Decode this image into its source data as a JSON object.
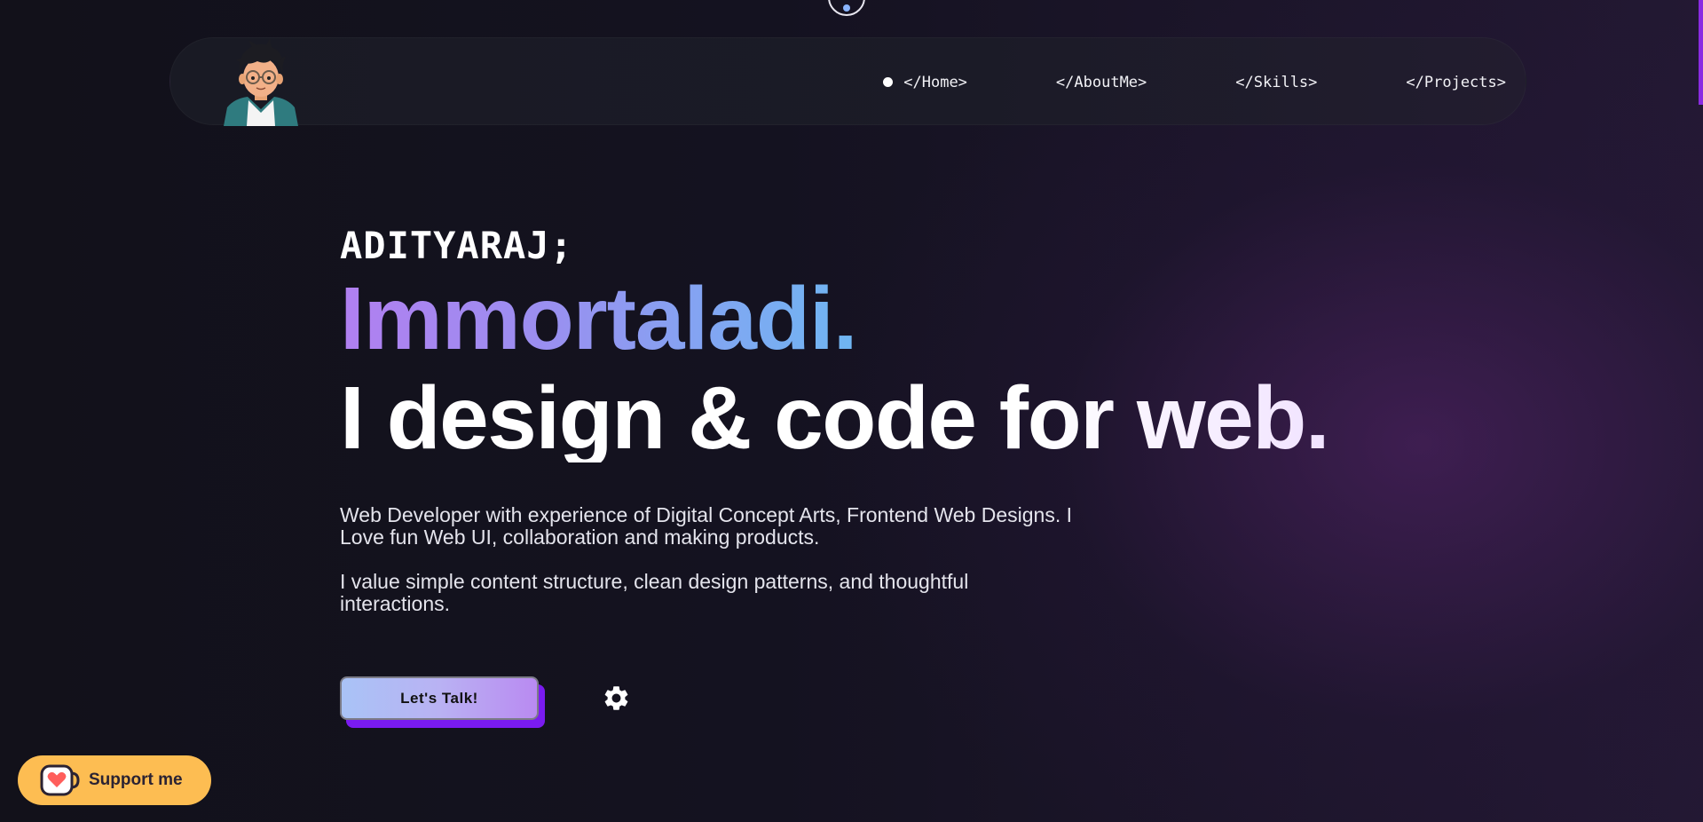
{
  "nav": {
    "items": [
      {
        "label": "</Home>",
        "active": true
      },
      {
        "label": "</AboutMe>",
        "active": false
      },
      {
        "label": "</Skills>",
        "active": false
      },
      {
        "label": "</Projects>",
        "active": false
      }
    ]
  },
  "hero": {
    "name": "ADITYARAJ;",
    "handle": "Immortaladi.",
    "tagline": "I design & code for web.",
    "paragraph_1": "Web Developer with experience of Digital Concept Arts, Frontend Web Designs. I Love fun Web UI, collaboration and making products.",
    "paragraph_2": "I value simple content structure, clean design patterns, and thoughtful interactions.",
    "cta_label": "Let's Talk!"
  },
  "support": {
    "label": "Support me",
    "icon": "kofi-cup-heart-icon"
  },
  "icons": {
    "settings": "gear-icon",
    "avatar": "avatar-illustration"
  },
  "colors": {
    "background": "#12111a",
    "accent_purple": "#7a1bf0",
    "handle_gradient_start": "#b17ff0",
    "handle_gradient_end": "#6fb6f2",
    "support_bg": "#fdbd52"
  }
}
